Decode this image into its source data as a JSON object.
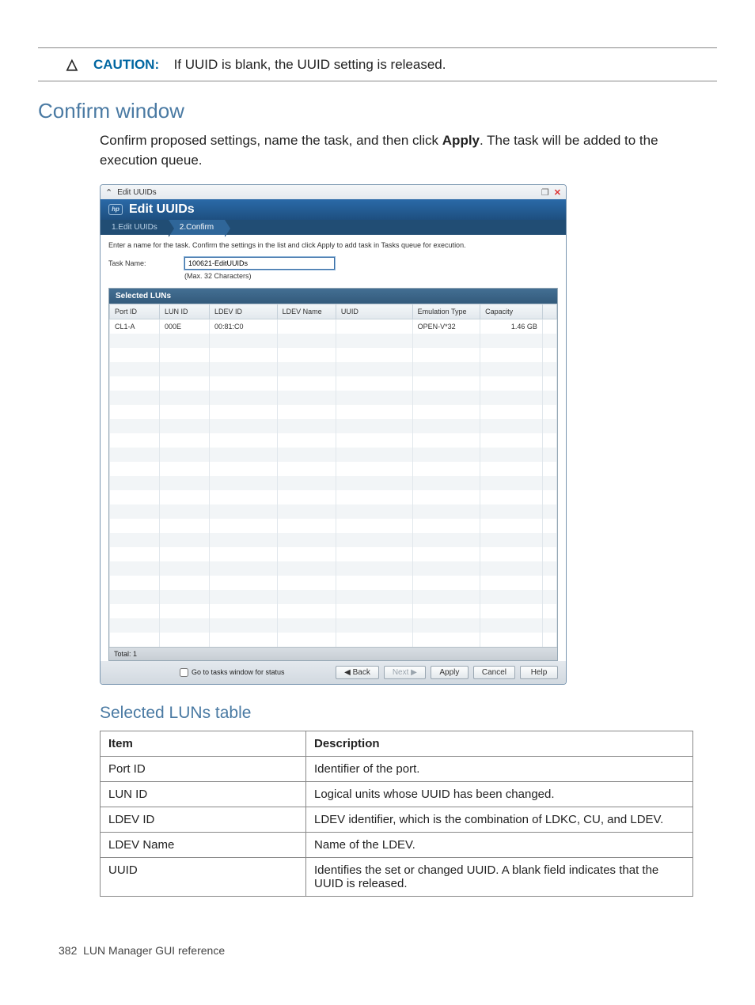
{
  "caution": {
    "label": "CAUTION:",
    "text": "If UUID is blank, the UUID setting is released."
  },
  "section_heading": "Confirm window",
  "section_body_pre": "Confirm proposed settings, name the task, and then click ",
  "section_body_bold": "Apply",
  "section_body_post": ". The task will be added to the execution queue.",
  "dialog": {
    "outer_title": "Edit UUIDs",
    "title": "Edit UUIDs",
    "steps": [
      "1.Edit UUIDs",
      "2.Confirm"
    ],
    "instruction": "Enter a name for the task. Confirm the settings in the list and click Apply to add task in Tasks queue for execution.",
    "task_name_label": "Task Name:",
    "task_name_value": "100621-EditUUIDs",
    "task_name_hint": "(Max. 32 Characters)",
    "luns_heading": "Selected LUNs",
    "columns": [
      "Port ID",
      "LUN ID",
      "LDEV ID",
      "LDEV Name",
      "UUID",
      "Emulation Type",
      "Capacity"
    ],
    "rows": [
      {
        "port_id": "CL1-A",
        "lun_id": "000E",
        "ldev_id": "00:81:C0",
        "ldev_name": "",
        "uuid": "",
        "emulation": "OPEN-V*32",
        "capacity": "1.46 GB"
      }
    ],
    "blank_rows": 22,
    "total_label": "Total: 1",
    "footer": {
      "checkbox_label": "Go to tasks window for status",
      "back": "Back",
      "next": "Next",
      "apply": "Apply",
      "cancel": "Cancel",
      "help": "Help"
    }
  },
  "luns_table_heading": "Selected LUNs table",
  "desc_table": {
    "headers": [
      "Item",
      "Description"
    ],
    "rows": [
      [
        "Port ID",
        "Identifier of the port."
      ],
      [
        "LUN ID",
        "Logical units whose UUID has been changed."
      ],
      [
        "LDEV ID",
        "LDEV identifier, which is the combination of LDKC, CU, and LDEV."
      ],
      [
        "LDEV Name",
        "Name of the LDEV."
      ],
      [
        "UUID",
        "Identifies the set or changed UUID. A blank field indicates that the UUID is released."
      ]
    ]
  },
  "page_footer": {
    "num": "382",
    "text": "LUN Manager GUI reference"
  }
}
